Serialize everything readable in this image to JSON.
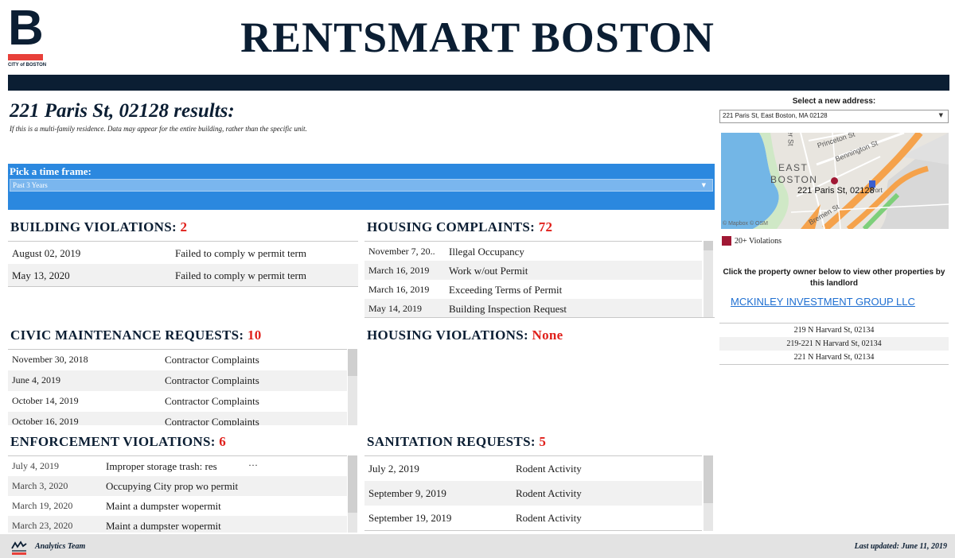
{
  "header": {
    "logo_letter": "B",
    "logo_text": "CITY of BOSTON",
    "title": "RENTSMART BOSTON"
  },
  "results": {
    "title": "221 Paris St, 02128 results:",
    "note": "If this is a multi-family residence. Data may appear for the entire building, rather than the specific unit."
  },
  "timeframe": {
    "label": "Pick a time frame:",
    "value": "Past 3 Years"
  },
  "building_violations": {
    "title": "BUILDING VIOLATIONS:",
    "count": "2",
    "rows": [
      {
        "date": "August 02, 2019",
        "desc": "Failed to comply w permit term"
      },
      {
        "date": "May 13, 2020",
        "desc": "Failed to comply w permit term"
      }
    ]
  },
  "housing_complaints": {
    "title": "HOUSING COMPLAINTS:",
    "count": "72",
    "rows": [
      {
        "date": "November 7, 20..",
        "desc": "Illegal Occupancy"
      },
      {
        "date": "March 16, 2019",
        "desc": "Work w/out Permit"
      },
      {
        "date": "March 16, 2019",
        "desc": "Exceeding Terms of Permit"
      },
      {
        "date": "May 14, 2019",
        "desc": "Building Inspection Request"
      }
    ]
  },
  "civic_maintenance": {
    "title": "CIVIC MAINTENANCE REQUESTS:",
    "count": "10",
    "rows": [
      {
        "date": "November 30, 2018",
        "desc": "Contractor Complaints"
      },
      {
        "date": "June 4, 2019",
        "desc": "Contractor Complaints"
      },
      {
        "date": "October 14, 2019",
        "desc": "Contractor Complaints"
      },
      {
        "date": "October 16, 2019",
        "desc": "Contractor Complaints"
      }
    ]
  },
  "housing_violations": {
    "title": "HOUSING VIOLATIONS:",
    "count": "None"
  },
  "enforcement_violations": {
    "title": "ENFORCEMENT VIOLATIONS:",
    "count": "6",
    "rows": [
      {
        "date": "July 4, 2019",
        "desc": "Improper storage trash: res",
        "more": "···"
      },
      {
        "date": "March 3, 2020",
        "desc": "Occupying City prop wo permit",
        "more": ""
      },
      {
        "date": "March 19, 2020",
        "desc": "Maint a dumpster wopermit",
        "more": ""
      },
      {
        "date": "March 23, 2020",
        "desc": "Maint a dumpster wopermit",
        "more": ""
      }
    ]
  },
  "sanitation": {
    "title": "SANITATION REQUESTS:",
    "count": "5",
    "rows": [
      {
        "date": "July 2, 2019",
        "desc": "Rodent Activity"
      },
      {
        "date": "September 9, 2019",
        "desc": "Rodent Activity"
      },
      {
        "date": "September 19, 2019",
        "desc": "Rodent Activity"
      }
    ]
  },
  "right_panel": {
    "address_label": "Select a new address:",
    "address_value": "221 Paris St, East Boston, MA 02128",
    "map": {
      "neighborhood_line1": "EAST",
      "neighborhood_line2": "BOSTON",
      "streets": [
        "Princeton St",
        "Bennington St",
        "Bremen St",
        "er St"
      ],
      "marker_label": "221 Paris St, 02128",
      "credit": "© Mapbox  © OSM",
      "port_label": "Port"
    },
    "legend_text": "20+ Violations",
    "legend_color": "#a01834",
    "owner_note": "Click the property owner below to view other properties by this landlord",
    "owner_name": "MCKINLEY INVESTMENT GROUP  LLC",
    "properties": [
      "219 N Harvard St, 02134",
      "219-221 N Harvard St, 02134",
      "221 N Harvard St, 02134"
    ]
  },
  "footer": {
    "team": "Analytics Team",
    "updated": "Last updated: June 11, 2019"
  },
  "colors": {
    "navy": "#0b1e33",
    "accent_red": "#e0201b",
    "timeframe_blue": "#2b88df",
    "link_blue": "#1f6fd1"
  }
}
